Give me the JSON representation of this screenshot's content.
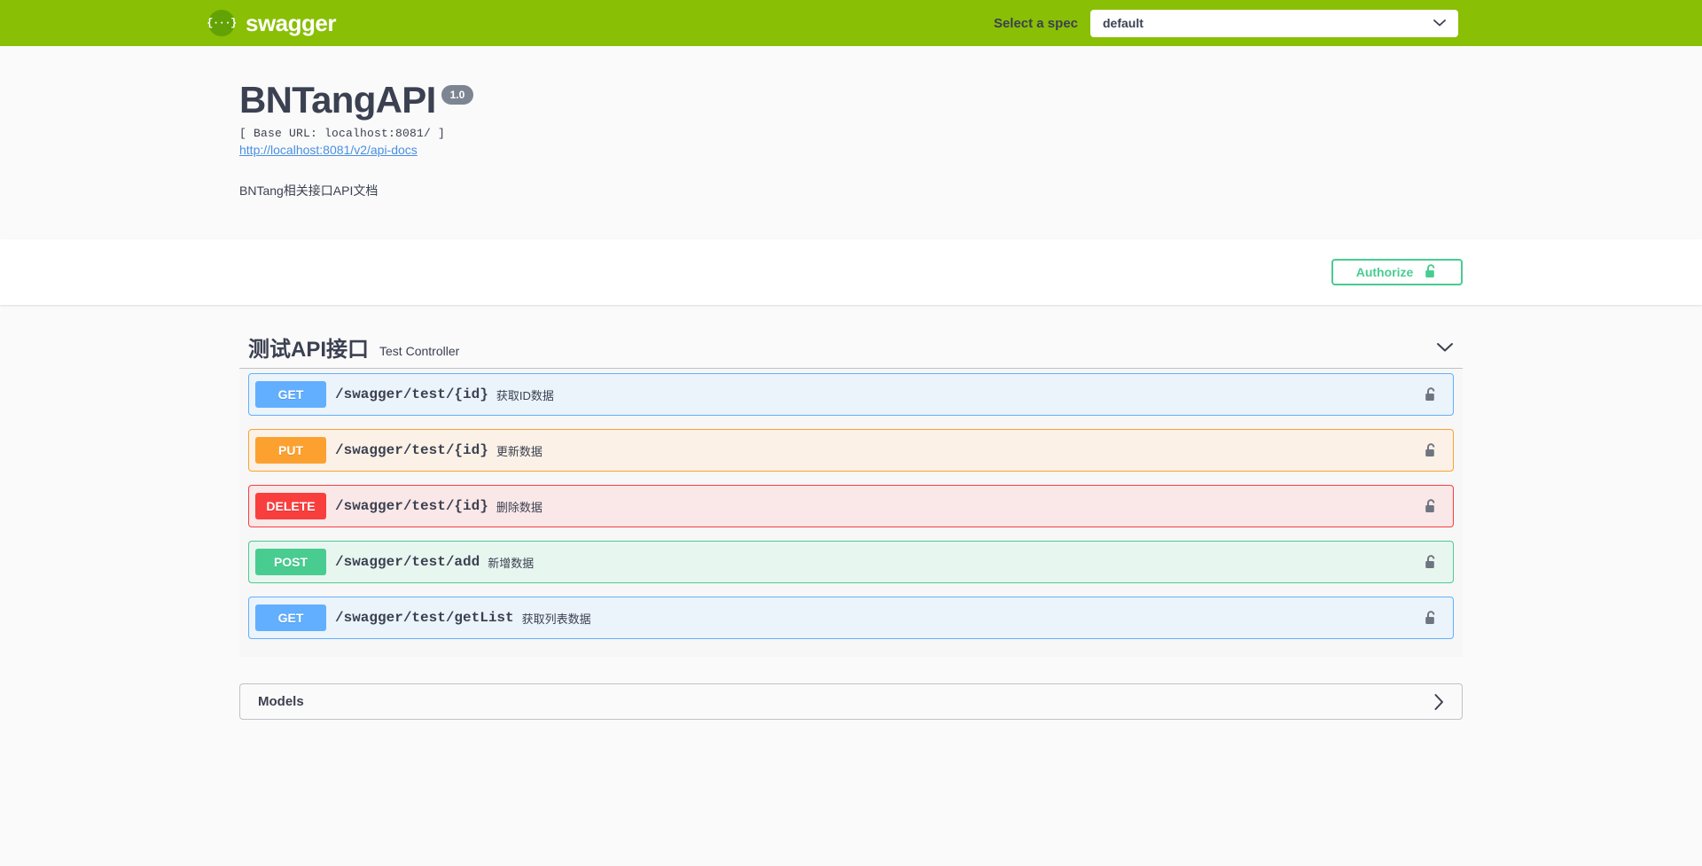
{
  "topbar": {
    "logo_text": "swagger",
    "logo_mark": "{···}",
    "spec_label": "Select a spec",
    "spec_selected": "default",
    "spec_options": [
      "default"
    ]
  },
  "info": {
    "title": "BNTangAPI",
    "version": "1.0",
    "base_url": "[ Base URL: localhost:8081/ ]",
    "docs_link": "http://localhost:8081/v2/api-docs",
    "description": "BNTang相关接口API文档"
  },
  "auth": {
    "authorize_label": "Authorize"
  },
  "tag": {
    "name": "测试API接口",
    "description": "Test Controller"
  },
  "operations": [
    {
      "method": "GET",
      "method_class": "get",
      "path": "/swagger/test/{id}",
      "summary": "获取ID数据"
    },
    {
      "method": "PUT",
      "method_class": "put",
      "path": "/swagger/test/{id}",
      "summary": "更新数据"
    },
    {
      "method": "DELETE",
      "method_class": "delete",
      "path": "/swagger/test/{id}",
      "summary": "删除数据"
    },
    {
      "method": "POST",
      "method_class": "post",
      "path": "/swagger/test/add",
      "summary": "新增数据"
    },
    {
      "method": "GET",
      "method_class": "get",
      "path": "/swagger/test/getList",
      "summary": "获取列表数据"
    }
  ],
  "models": {
    "title": "Models"
  },
  "colors": {
    "brand_green": "#89bf04",
    "get": "#61affe",
    "put": "#fca130",
    "delete": "#f93e3e",
    "post": "#49cc90",
    "authorize": "#49cc90",
    "text": "#3b4151",
    "link": "#4990e2"
  }
}
